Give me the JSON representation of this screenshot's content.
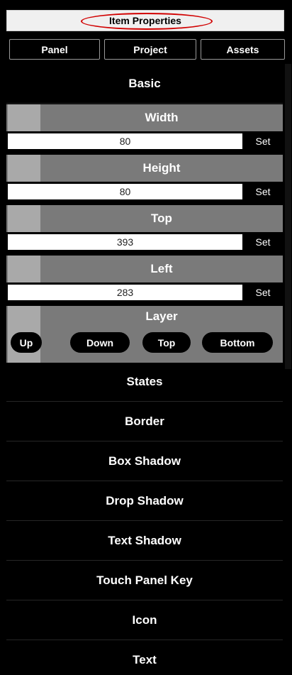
{
  "title": "Item Properties",
  "tabs": [
    "Panel",
    "Project",
    "Assets"
  ],
  "basic": {
    "header": "Basic",
    "properties": [
      {
        "label": "Width",
        "value": "80",
        "button": "Set"
      },
      {
        "label": "Height",
        "value": "80",
        "button": "Set"
      },
      {
        "label": "Top",
        "value": "393",
        "button": "Set"
      },
      {
        "label": "Left",
        "value": "283",
        "button": "Set"
      }
    ],
    "layer": {
      "label": "Layer",
      "buttons": [
        "Up",
        "Down",
        "Top",
        "Bottom"
      ]
    }
  },
  "sections": [
    "States",
    "Border",
    "Box Shadow",
    "Drop Shadow",
    "Text Shadow",
    "Touch Panel Key",
    "Icon",
    "Text"
  ],
  "colors": {
    "background": "#000000",
    "property_bar": "#7a7a7a",
    "property_square": "#a9a9a9",
    "title_highlight": "#d10000"
  }
}
